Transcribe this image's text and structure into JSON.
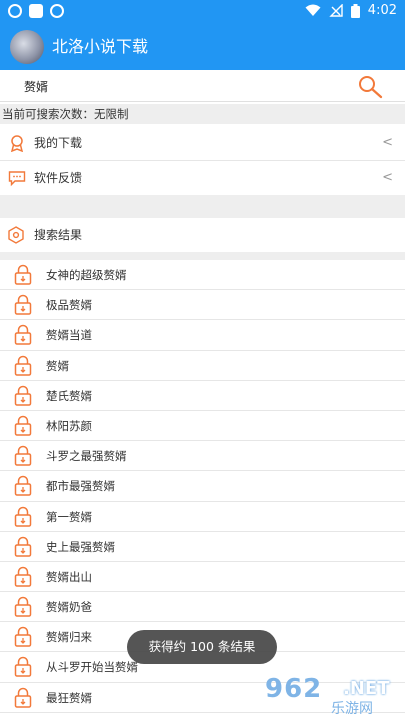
{
  "status_bar": {
    "time": "4:02"
  },
  "app_bar": {
    "title": "北洛小说下载"
  },
  "search": {
    "query": "赘婿"
  },
  "quota": {
    "text": "当前可搜索次数：无限制"
  },
  "menu": [
    {
      "label": "我的下载",
      "icon": "ribbon-icon",
      "chevron": "<"
    },
    {
      "label": "软件反馈",
      "icon": "message-icon",
      "chevron": "<"
    }
  ],
  "results": {
    "header_label": "搜索结果",
    "items": [
      "女神的超级赘婿",
      "极品赘婿",
      "赘婿当道",
      "赘婿",
      "楚氏赘婿",
      "林阳苏颜",
      "斗罗之最强赘婿",
      "都市最强赘婿",
      "第一赘婿",
      "史上最强赘婿",
      "赘婿出山",
      "赘婿奶爸",
      "赘婿归来",
      "从斗罗开始当赘婿",
      "最狂赘婿"
    ]
  },
  "toast": {
    "text": "获得约 100 条结果"
  },
  "watermark": {
    "number": "962",
    "suffix": ".NET",
    "sub": "乐游网"
  },
  "colors": {
    "primary": "#2196f3",
    "accent": "#f2793a",
    "background_gray": "#eeeeee"
  }
}
